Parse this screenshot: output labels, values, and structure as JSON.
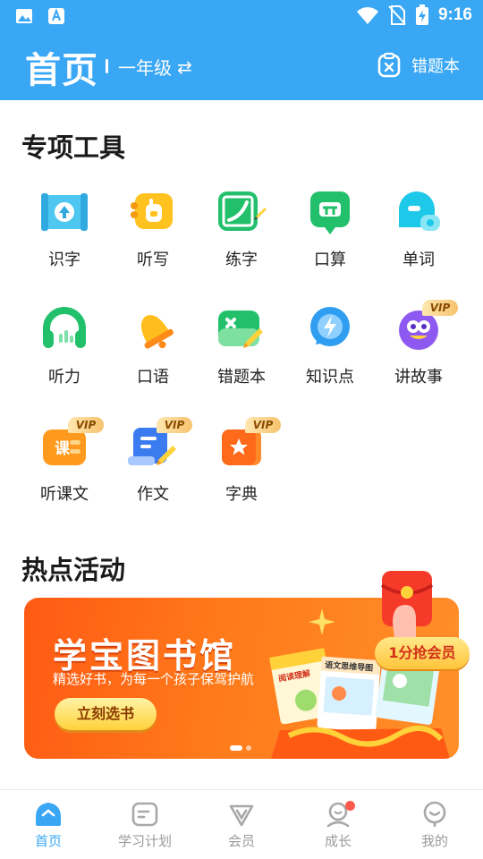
{
  "status_bar": {
    "time": "9:16",
    "icons": [
      "gallery-icon",
      "text-app-icon",
      "wifi-icon",
      "no-sim-icon",
      "battery-charging-icon"
    ]
  },
  "header": {
    "title": "首页",
    "grade": "一年级",
    "mistake_book": "错题本",
    "grade_switch_glyph": "⇄"
  },
  "sections": {
    "tools_title": "专项工具",
    "activities_title": "热点活动"
  },
  "tools": [
    {
      "label": "识字",
      "icon": "literacy-icon",
      "vip": false
    },
    {
      "label": "听写",
      "icon": "dictation-icon",
      "vip": false
    },
    {
      "label": "练字",
      "icon": "handwriting-icon",
      "vip": false
    },
    {
      "label": "口算",
      "icon": "mental-math-icon",
      "vip": false
    },
    {
      "label": "单词",
      "icon": "words-icon",
      "vip": false
    },
    {
      "label": "听力",
      "icon": "headphones-icon",
      "vip": false
    },
    {
      "label": "口语",
      "icon": "bell-icon",
      "vip": false
    },
    {
      "label": "错题本",
      "icon": "mistake-book-icon",
      "vip": false
    },
    {
      "label": "知识点",
      "icon": "lightning-icon",
      "vip": false
    },
    {
      "label": "讲故事",
      "icon": "story-icon",
      "vip": true
    },
    {
      "label": "听课文",
      "icon": "lesson-icon",
      "vip": true
    },
    {
      "label": "作文",
      "icon": "essay-icon",
      "vip": true
    },
    {
      "label": "字典",
      "icon": "dictionary-icon",
      "vip": true
    }
  ],
  "vip_label": "VIP",
  "lesson_icon_text": "课",
  "banner": {
    "title": "学宝图书馆",
    "subtitle": "精选好书，为每一个孩子保驾护航",
    "button": "立刻选书",
    "badge": "1分抢会员",
    "book_title_1": "阅读理解",
    "book_title_2": "语文思维导图"
  },
  "bottom_nav": [
    {
      "label": "首页",
      "icon": "home-icon",
      "active": true
    },
    {
      "label": "学习计划",
      "icon": "study-plan-icon",
      "active": false
    },
    {
      "label": "会员",
      "icon": "vip-icon",
      "active": false
    },
    {
      "label": "成长",
      "icon": "growth-icon",
      "active": false,
      "badge": true
    },
    {
      "label": "我的",
      "icon": "profile-icon",
      "active": false
    }
  ],
  "colors": {
    "primary": "#3aa7f5",
    "banner": "#ff6a1a",
    "vip_gold": "#f6c36e",
    "notice_dot": "#ff5a4e"
  }
}
